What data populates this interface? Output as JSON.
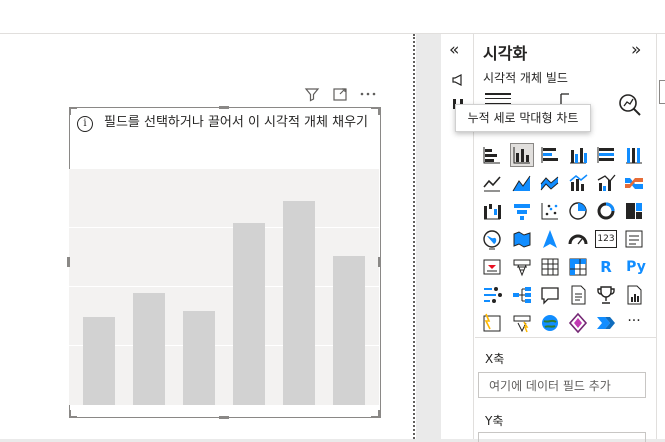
{
  "visual": {
    "info_text": "필드를 선택하거나 끌어서 이 시각적 개체 채우기",
    "placeholder_bars": [
      0.43,
      0.55,
      0.46,
      0.89,
      1.0,
      0.73
    ]
  },
  "pane": {
    "title": "시각화",
    "subtitle": "시각적 개체 빌드",
    "collapse_glyph": "«",
    "expand_glyph": "»",
    "tooltip": "누적 세로 막대형 차트",
    "x_well": {
      "label": "X축",
      "placeholder": "여기에 데이터 필드 추가"
    },
    "y_well": {
      "label": "Y축"
    },
    "r_label": "R",
    "py_label": "Py",
    "more_glyph": "···",
    "card_label": "123"
  },
  "colors": {
    "accent_blue": "#118dff",
    "placeholder_bar": "#d2d2d2",
    "icon_dark": "#252423"
  }
}
